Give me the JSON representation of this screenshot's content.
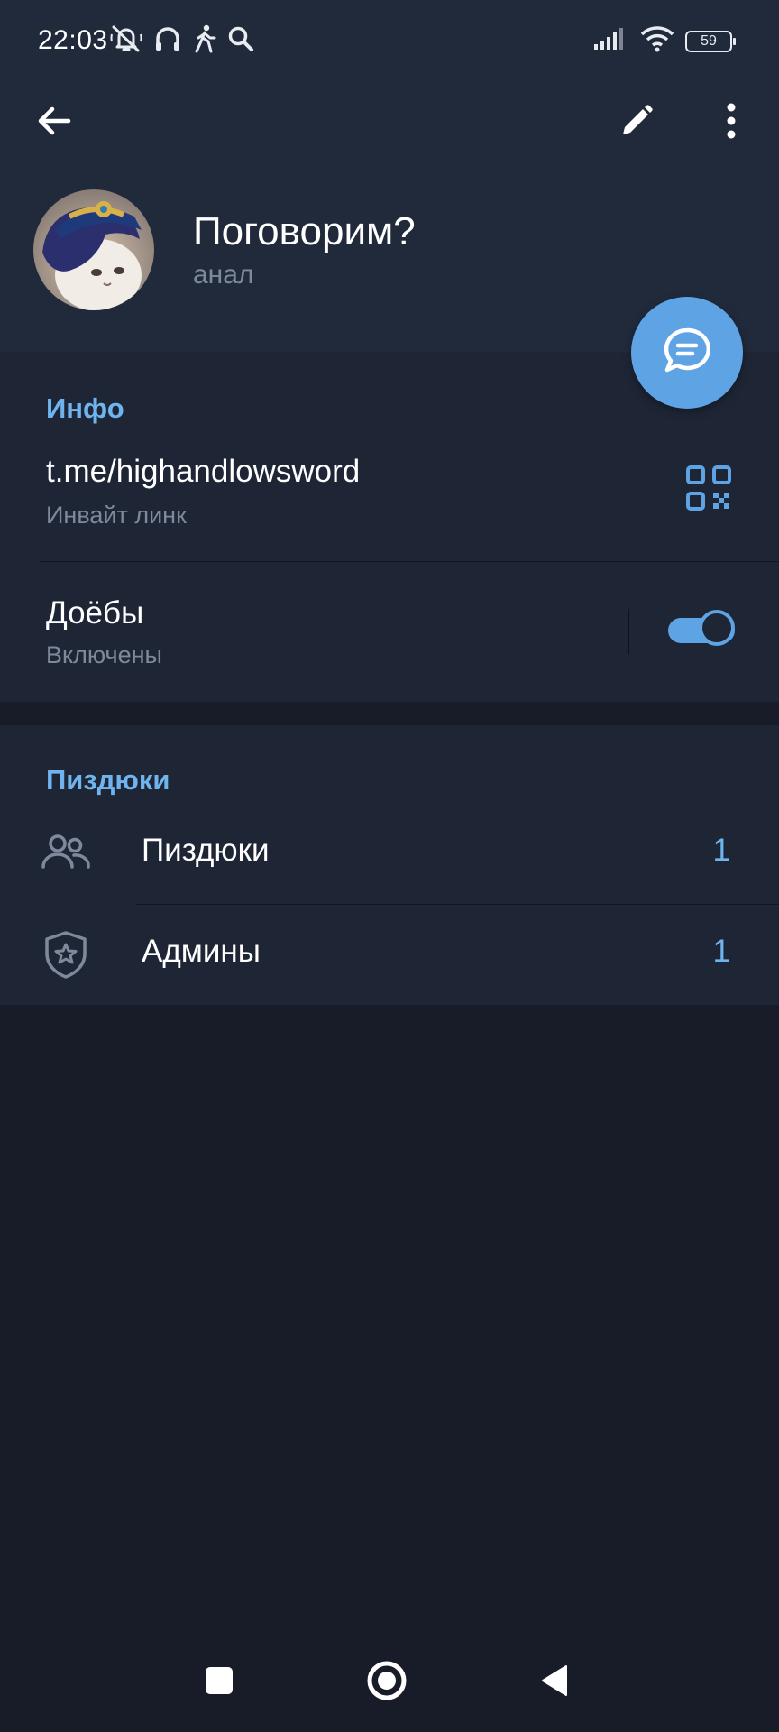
{
  "status_bar": {
    "time": "22:03",
    "battery": "59",
    "icons_left": [
      "mute-alarm-icon",
      "headphones-icon",
      "walking-icon",
      "search-icon"
    ],
    "icons_right": [
      "signal-icon",
      "wifi-icon",
      "battery-icon"
    ]
  },
  "toolbar": {
    "back_icon": "arrow-left-icon",
    "edit_icon": "pencil-icon",
    "more_icon": "more-vertical-icon"
  },
  "profile": {
    "title": "Поговорим?",
    "subtitle": "анал"
  },
  "info_section": {
    "title": "Инфо",
    "link": "t.me/highandlowsword",
    "link_caption": "Инвайт линк",
    "setting_label": "Доёбы",
    "setting_value": "Включены",
    "setting_enabled": true
  },
  "members_section": {
    "title": "Пиздюки",
    "rows": [
      {
        "label": "Пиздюки",
        "count": "1",
        "icon": "people-icon"
      },
      {
        "label": "Админы",
        "count": "1",
        "icon": "shield-star-icon"
      }
    ]
  },
  "colors": {
    "accent": "#5ea3e4",
    "accent_text": "#6fb4ee",
    "header_bg": "#212a3b",
    "section_bg": "#1e2636",
    "page_bg": "#171c28"
  }
}
